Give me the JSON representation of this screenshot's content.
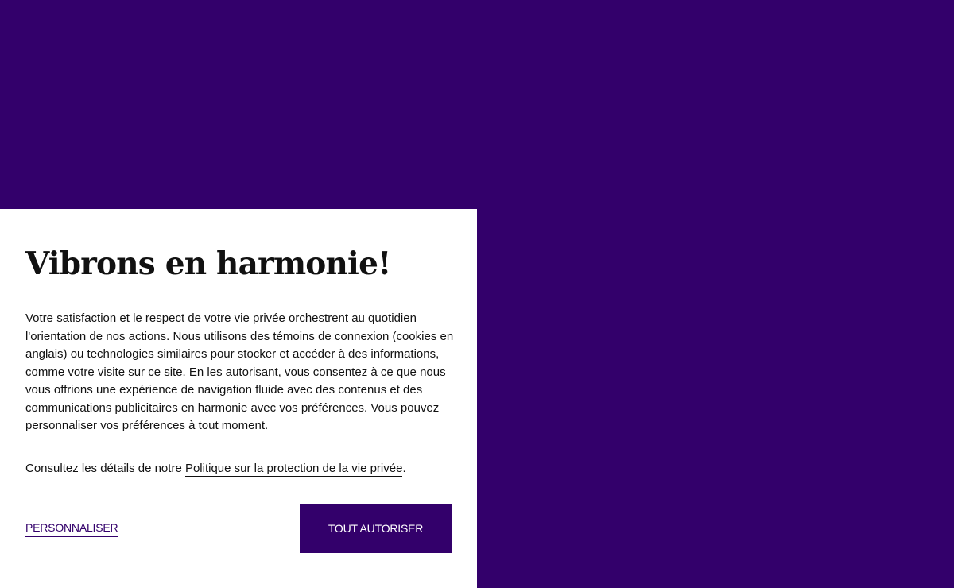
{
  "colors": {
    "background": "#33006b",
    "panel": "#ffffff",
    "text": "#111111",
    "accent": "#33006b",
    "button_text": "#ffffff"
  },
  "consent": {
    "title": "Vibrons en harmonie!",
    "body": "Votre satisfaction et le respect de votre vie privée orchestrent au quotidien l'orientation de nos actions. Nous utilisons des témoins de connexion (cookies en anglais) ou technologies similaires pour stocker et accéder à des informations, comme votre visite sur ce site. En les autorisant, vous consentez à ce que nous vous offrions une expérience de navigation fluide avec des contenus et des communications publicitaires en harmonie avec vos préférences. Vous pouvez personnaliser vos préférences à tout moment.",
    "policy_prefix": "Consultez les détails de notre ",
    "policy_link": "Politique sur la protection de la vie privée",
    "policy_suffix": ".",
    "personalize_label": "PERSONNALISER",
    "accept_label": "TOUT AUTORISER"
  }
}
